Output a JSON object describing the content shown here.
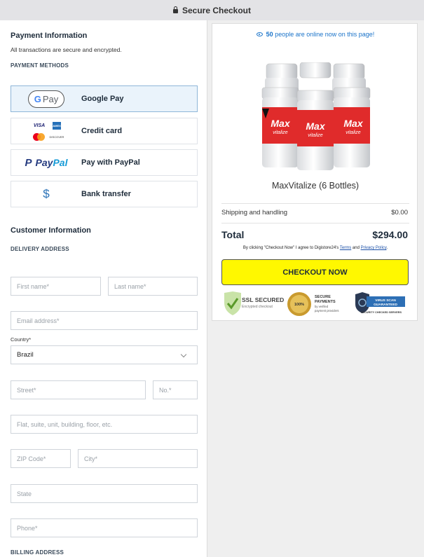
{
  "topbar": {
    "title": "Secure Checkout"
  },
  "payment": {
    "title": "Payment Information",
    "subtitle": "All transactions are secure and encrypted.",
    "methods_heading": "PAYMENT METHODS",
    "methods": [
      {
        "label": "Google Pay",
        "logo_text": "Pay"
      },
      {
        "label": "Credit card",
        "logo_visa": "VISA",
        "logo_amex": "AMEX",
        "logo_dc": "DISCOVER"
      },
      {
        "label": "Pay with PayPal",
        "logo_text_1": "Pay",
        "logo_text_2": "Pal"
      },
      {
        "label": "Bank transfer",
        "logo_text": "$"
      }
    ]
  },
  "customer": {
    "title": "Customer Information",
    "delivery_heading": "DELIVERY ADDRESS",
    "first_name_placeholder": "First name*",
    "last_name_placeholder": "Last name*",
    "email_placeholder": "Email address*",
    "country_label": "Country*",
    "country_value": "Brazil",
    "street_placeholder": "Street*",
    "no_placeholder": "No.*",
    "flat_placeholder": "Flat, suite, unit, building, floor, etc.",
    "zip_placeholder": "ZIP Code*",
    "city_placeholder": "City*",
    "state_placeholder": "State",
    "phone_placeholder": "Phone*",
    "billing_heading": "BILLING ADDRESS"
  },
  "summary": {
    "online_count": "50",
    "online_text": "people are online now on this page!",
    "product_brand": "Max",
    "product_brand_sub": "vitalize",
    "product_name": "MaxVitalize (6 Bottles)",
    "shipping_label": "Shipping and handling",
    "shipping_value": "$0.00",
    "total_label": "Total",
    "total_value": "$294.00",
    "terms_prefix": "By clicking \"Checkout Now\" I agree to Digistore24's",
    "terms_link": "Terms",
    "terms_and": "and",
    "privacy_link": "Privacy Policy",
    "checkout_label": "CHECKOUT NOW",
    "badges": {
      "ssl_title": "SSL SECURED",
      "ssl_sub": "Encrypted checkout",
      "secure_title_1": "SECURE",
      "secure_title_2": "PAYMENTS",
      "secure_sub_1": "by verified",
      "secure_sub_2": "payment providers",
      "seal_text": "100%",
      "virus_1": "VIRUS SCAN",
      "virus_2": "GUARANTEED",
      "virus_sub": "SECURITY CHECKED SERVERS"
    }
  },
  "colors": {
    "checkout_button": "#fff800",
    "link_blue": "#1a73c9",
    "selected_method_bg": "#eaf3fb",
    "bottle_red": "#e02b2b"
  }
}
